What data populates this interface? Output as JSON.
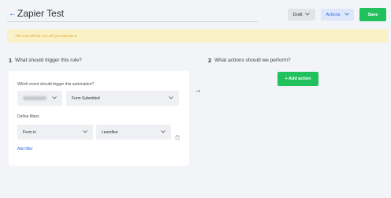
{
  "header": {
    "back_icon": "←",
    "title": "Zapier Test",
    "status_value": "Draft",
    "actions_label": "Actions",
    "save_label": "Save"
  },
  "banner": {
    "text": "This rule will not run until you activate it."
  },
  "trigger_section": {
    "number": "1",
    "title": "What should trigger this rule?",
    "event_label": "Which event should trigger this automation?",
    "event_value": "Form Submitted",
    "filters_label": "Define filters",
    "filter_condition": "Form is",
    "filter_value": "Leamfiee",
    "add_filter_label": "Add filter"
  },
  "arrow": "→",
  "actions_section": {
    "number": "2",
    "title": "What actions should we perform?",
    "add_action_label": "+ Add action"
  },
  "colors": {
    "primary": "#2d6cdf",
    "success": "#21c25e",
    "warning_bg": "#fbf1c7",
    "warning_text": "#e0a31a",
    "background": "#f3f4f7"
  }
}
